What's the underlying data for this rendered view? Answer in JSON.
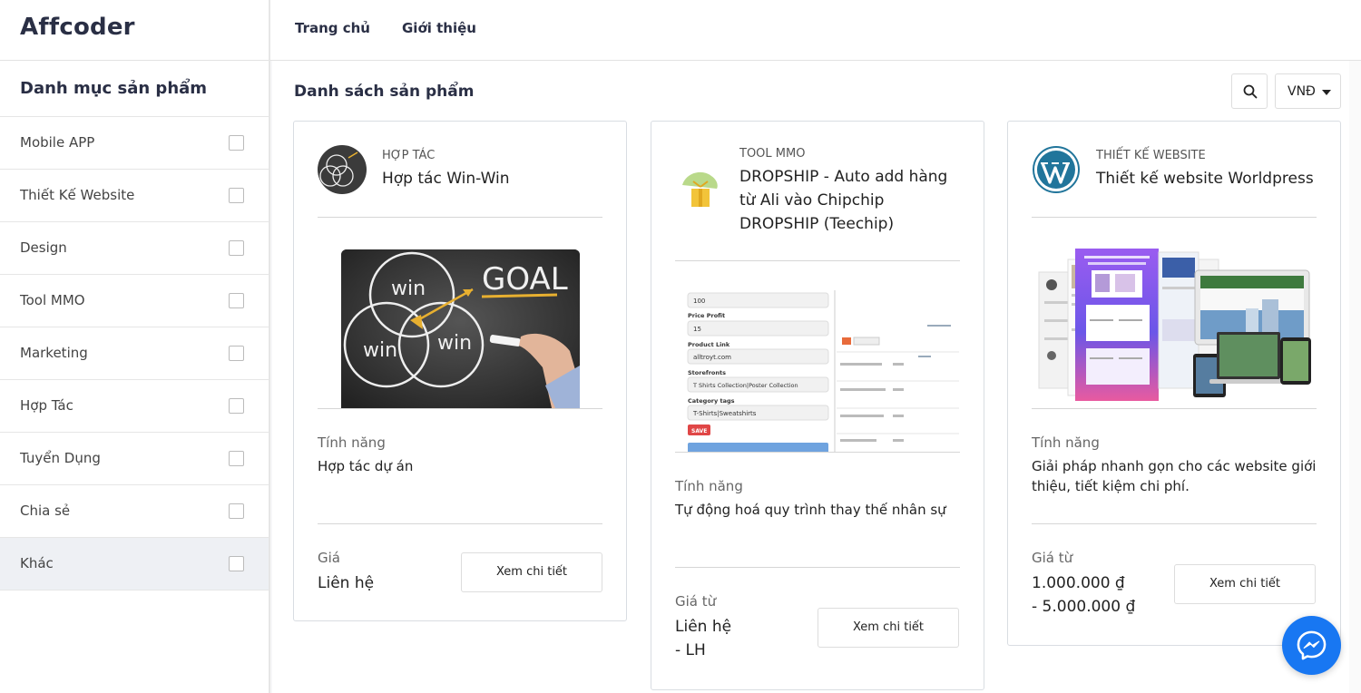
{
  "app": {
    "logo": "Affcoder"
  },
  "nav": [
    {
      "label": "Trang chủ"
    },
    {
      "label": "Giới thiệu"
    }
  ],
  "sidebar": {
    "title": "Danh mục sản phẩm",
    "items": [
      {
        "label": "Mobile APP"
      },
      {
        "label": "Thiết Kế Website"
      },
      {
        "label": "Design"
      },
      {
        "label": "Tool MMO"
      },
      {
        "label": "Marketing"
      },
      {
        "label": "Hợp Tác"
      },
      {
        "label": "Tuyển Dụng"
      },
      {
        "label": "Chia sẻ"
      },
      {
        "label": "Khác"
      }
    ]
  },
  "main": {
    "title": "Danh sách sản phẩm",
    "search_icon": "search-icon",
    "currency": "VNĐ"
  },
  "cards": [
    {
      "category": "HỢP TÁC",
      "name": "Hợp tác Win-Win",
      "image_texts": {
        "goal": "GOAL",
        "win1": "win",
        "win2": "win",
        "win3": "win"
      },
      "feature_label": "Tính năng",
      "feature": "Hợp tác dự án",
      "price_label": "Giá",
      "price_line1": "Liên hệ",
      "price_line2": "",
      "button": "Xem chi tiết"
    },
    {
      "category": "TOOL MMO",
      "name": "DROPSHIP - Auto add hàng từ Ali vào Chipchip DROPSHIP (Teechip)",
      "image_texts": {
        "qty": "100",
        "price_profit_label": "Price Profit",
        "price_profit": "15",
        "product_link_label": "Product Link",
        "product_link": "alltroyt.com",
        "storefronts_label": "Storefronts",
        "storefronts": "T Shirts Collection|Poster Collection",
        "category_tags_label": "Category tags",
        "category_tags": "T-Shirts|Sweatshirts",
        "save": "SAVE"
      },
      "feature_label": "Tính năng",
      "feature": "Tự động hoá quy trình thay thế nhân sự",
      "price_label": "Giá từ",
      "price_line1": "Liên hệ",
      "price_line2": "- LH",
      "button": "Xem chi tiết"
    },
    {
      "category": "THIẾT KẾ WEBSITE",
      "name": "Thiết kế website Worldpress",
      "feature_label": "Tính năng",
      "feature": "Giải pháp nhanh gọn cho các website giới thiệu, tiết kiệm chi phí.",
      "price_label": "Giá từ",
      "price_line1": "1.000.000 ₫",
      "price_line2": "- 5.000.000 ₫",
      "button": "Xem chi tiết"
    }
  ],
  "messenger_icon": "messenger-icon",
  "colors": {
    "messenger": "#1877f2",
    "wordpress": "#21759b",
    "nav_text": "#2a2f45"
  }
}
